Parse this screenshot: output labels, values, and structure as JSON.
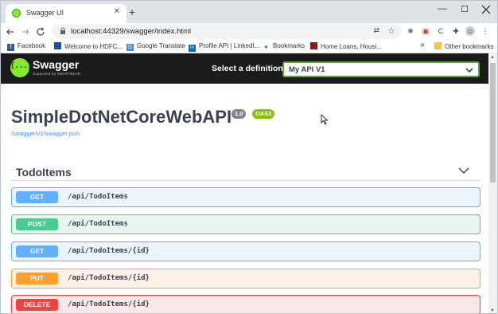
{
  "browser": {
    "tab_title": "Swagger UI",
    "tab_close": "✕",
    "new_tab": "+",
    "url": "localhost:44329/swagger/index.html",
    "window_controls": {
      "minimize": "—",
      "maximize": "☐"
    }
  },
  "bookmarks": [
    {
      "label": "Facebook",
      "icon": "facebook-icon",
      "color": "#3b5998",
      "glyph": "f"
    },
    {
      "label": "Welcome to HDFC...",
      "icon": "hdfc-icon",
      "color": "#1f4e9c",
      "glyph": ""
    },
    {
      "label": "Google Translate",
      "icon": "translate-icon",
      "color": "#4285f4",
      "glyph": "G"
    },
    {
      "label": "Profile API | LinkedI...",
      "icon": "linkedin-icon",
      "color": "#0a66c2",
      "glyph": "in"
    },
    {
      "label": "Bookmarks",
      "icon": "star-icon",
      "color": "#1a73e8",
      "glyph": "★"
    },
    {
      "label": "Home Loans, Housi...",
      "icon": "home-loans-icon",
      "color": "#8b1a1a",
      "glyph": ""
    },
    {
      "label": "Other bookmarks",
      "icon": "folder-icon",
      "color": "#f4c542",
      "glyph": ""
    }
  ],
  "bookmarks_overflow": "»",
  "swagger": {
    "brand": "Swagger",
    "brand_sub": "Supported by SMARTBEAR",
    "logo_glyph": "{...}",
    "definition_label": "Select a definition",
    "definition_value": "My API V1",
    "title": "SimpleDotNetCoreWebAPI",
    "version": "1.0",
    "oas": "OAS3",
    "spec_url": "/swagger/v1/swagger.json",
    "tag": "TodoItems"
  },
  "operations": [
    {
      "method": "GET",
      "path": "/api/TodoItems",
      "color": "#61affe",
      "border": "#61affe",
      "bg": "#ebf3fb"
    },
    {
      "method": "POST",
      "path": "/api/TodoItems",
      "color": "#49cc90",
      "border": "#49cc90",
      "bg": "#e8f6f0"
    },
    {
      "method": "GET",
      "path": "/api/TodoItems/{id}",
      "color": "#61affe",
      "border": "#61affe",
      "bg": "#ebf3fb"
    },
    {
      "method": "PUT",
      "path": "/api/TodoItems/{id}",
      "color": "#fca130",
      "border": "#fca130",
      "bg": "#fbf1e6"
    },
    {
      "method": "DELETE",
      "path": "/api/TodoItems/{id}",
      "color": "#f93e3e",
      "border": "#f93e3e",
      "bg": "#fae7e7"
    }
  ]
}
